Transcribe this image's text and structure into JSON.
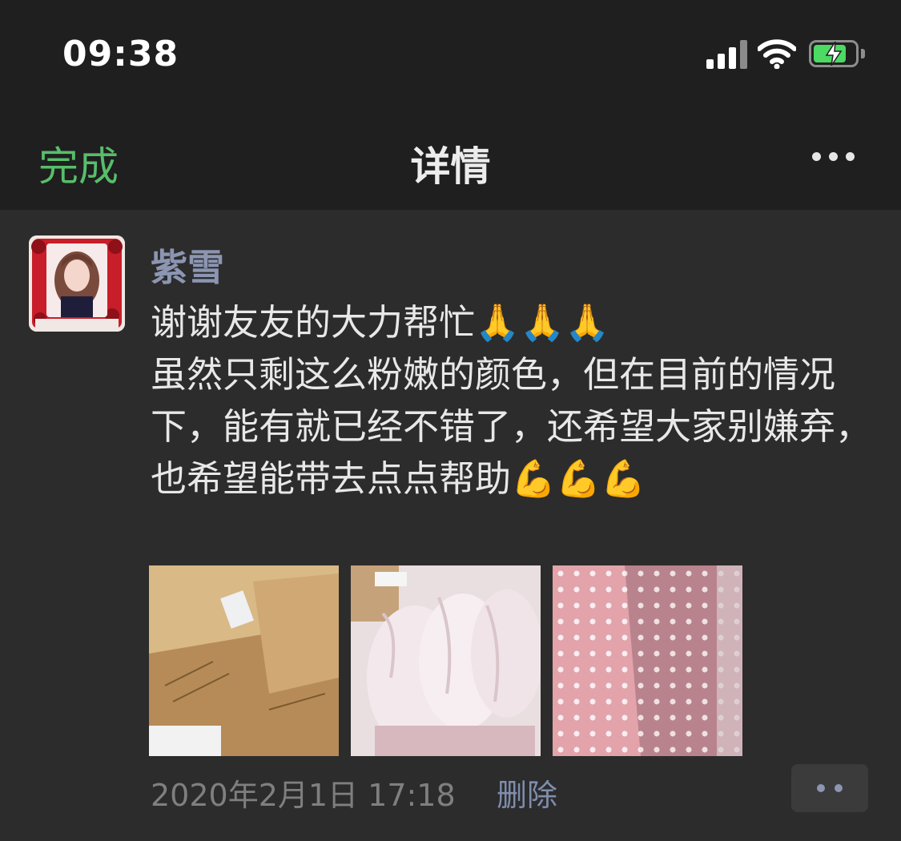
{
  "status_bar": {
    "time": "09:38",
    "icons": [
      "signal-icon",
      "wifi-icon",
      "battery-charging-icon"
    ],
    "battery_color": "#4cd964",
    "battery_level": 0.8
  },
  "nav": {
    "done_label": "完成",
    "title": "详情",
    "more_icon": "more-icon",
    "done_color": "#57be6a"
  },
  "post": {
    "author": "紫雪",
    "author_color": "#8c96b2",
    "content": "谢谢友友的大力帮忙🙏🙏🙏\n虽然只剩这么粉嫩的颜色，但在目前的情况下，能有就已经不错了，还希望大家别嫌弃，也希望能带去点点帮助💪💪💪",
    "photos": [
      {
        "name": "photo-cardboard-boxes"
      },
      {
        "name": "photo-wrapped-pink-masks"
      },
      {
        "name": "photo-pink-polka-dot-masks"
      }
    ],
    "timestamp": "2020年2月1日 17:18",
    "delete_label": "删除",
    "actions_icon": "comment-actions-icon"
  }
}
